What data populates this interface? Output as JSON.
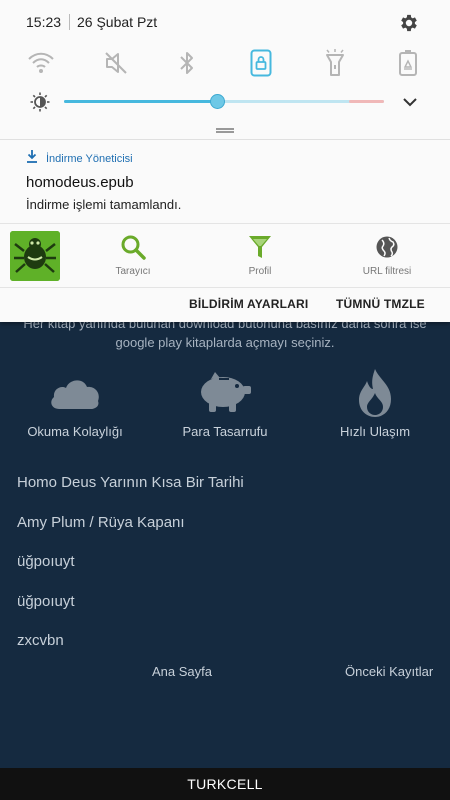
{
  "status_bar": {
    "time": "15:23",
    "date": "26 Şubat Pzt"
  },
  "quick_settings": {
    "tiles": [
      {
        "icon": "wifi-icon",
        "active": false
      },
      {
        "icon": "sound-muted-icon",
        "active": false
      },
      {
        "icon": "bluetooth-icon",
        "active": false
      },
      {
        "icon": "rotation-lock-icon",
        "active": true
      },
      {
        "icon": "flashlight-icon",
        "active": false
      },
      {
        "icon": "power-saving-icon",
        "active": false
      }
    ],
    "brightness_level": 0.48,
    "accent_color": "#46b8de"
  },
  "download_notification": {
    "app_name": "İndirme Yöneticisi",
    "title": "homodeus.epub",
    "text": "İndirme işlemi tamamlandı."
  },
  "app_notification": {
    "actions": [
      {
        "icon": "search-icon",
        "label": "Tarayıcı"
      },
      {
        "icon": "filter-icon",
        "label": "Profil"
      },
      {
        "icon": "globe-icon",
        "label": "URL filtresi"
      }
    ],
    "action_color": "#6aaa2a"
  },
  "shade_buttons": {
    "settings": "BİLDİRİM AYARLARI",
    "clear_all": "TÜMNÜ TMZLE"
  },
  "background_app": {
    "hint": "Her kitap yanında bulunan download butonuna basınız daha sonra ise google play kitaplarda açmayı seçiniz.",
    "features": [
      {
        "icon": "cloud-icon",
        "label": "Okuma Kolaylığı"
      },
      {
        "icon": "piggy-bank-icon",
        "label": "Para Tasarrufu"
      },
      {
        "icon": "flame-icon",
        "label": "Hızlı Ulaşım"
      }
    ],
    "history": [
      "Homo Deus Yarının Kısa Bir Tarihi",
      "Amy Plum / Rüya Kapanı",
      "üğpoıuyt",
      "üğpoıuyt",
      "zxcvbn"
    ],
    "nav": {
      "home": "Ana Sayfa",
      "previous": "Önceki Kayıtlar"
    }
  },
  "carrier": "TURKCELL"
}
